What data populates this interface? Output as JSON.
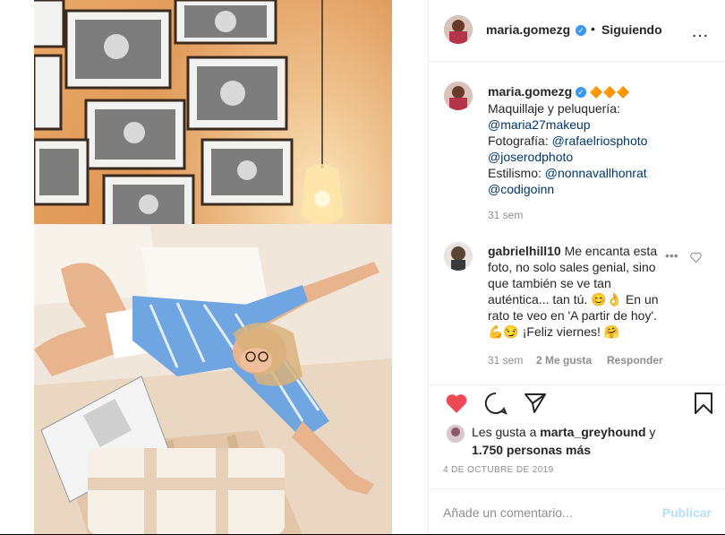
{
  "post": {
    "username": "maria.gomezg",
    "follow_status": "Siguiendo",
    "more_icon": "…"
  },
  "caption": {
    "username": "maria.gomezg",
    "badges": "🔶🔶🔶",
    "line1": "Maquillaje y peluquería:",
    "link1": "@maria27makeup",
    "line2_prefix": "Fotografía: ",
    "link2": "@rafaelriosphoto",
    "link3": "@joserodphoto",
    "line3_prefix": "Estilismo: ",
    "link4": "@nonnavallhonrat",
    "link5": "@codigoinn",
    "time": "31 sem"
  },
  "comment": {
    "username": "gabrielhill10",
    "line1": "Me encanta esta",
    "line2": "foto, no solo sales genial, sino",
    "line3": "que también se ve tan",
    "line4": "auténtica... tan tú. 😊👌 En un",
    "line5": "rato te veo en 'A partir de hoy'.",
    "line6": "💪😏 ¡Feliz viernes! 🤗",
    "time": "31 sem",
    "likes": "2 Me gusta",
    "reply": "Responder"
  },
  "likes": {
    "prefix": "Les gusta a",
    "user": "marta_greyhound",
    "joiner": "y",
    "others": "1.750 personas más"
  },
  "date": "4 DE OCTUBRE DE 2019",
  "add_comment": {
    "placeholder": "Añade un comentario...",
    "publish": "Publicar"
  },
  "colors": {
    "heart": "#ed4956",
    "link": "#00376b",
    "verified": "#3897f0",
    "publish_disabled": "#b2dffc"
  }
}
